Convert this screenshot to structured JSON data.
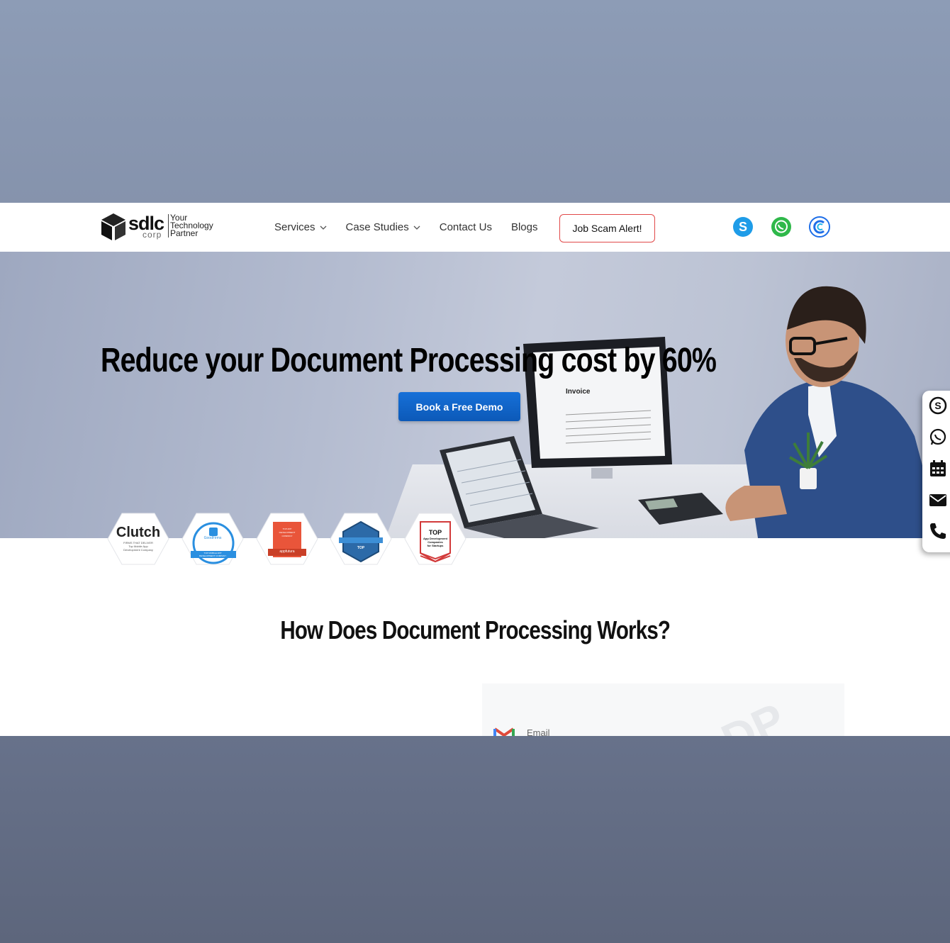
{
  "header": {
    "logo": {
      "word": "sdlc",
      "corp": "corp",
      "tagline": [
        "Your",
        "Technology",
        "Partner"
      ]
    },
    "nav": [
      {
        "label": "Services",
        "has_dropdown": true
      },
      {
        "label": "Case Studies",
        "has_dropdown": true
      },
      {
        "label": "Contact Us",
        "has_dropdown": false
      },
      {
        "label": "Blogs",
        "has_dropdown": false
      }
    ],
    "alert_button": "Job Scam Alert!",
    "icons": [
      "skype-icon",
      "whatsapp-icon",
      "calendly-icon"
    ]
  },
  "hero": {
    "title": "Reduce your Document Processing cost by 60%",
    "cta": "Book a Free Demo",
    "image_text": "Invoice",
    "badges": [
      {
        "name": "clutch-badge",
        "title": "Clutch",
        "lines": [
          "FIRMS THAT DELIVER",
          "Top Mobile App",
          "Development Company"
        ]
      },
      {
        "name": "goodfirms-badge",
        "title": "GoodFirms",
        "lines": [
          "TOP MOBILE APP",
          "DEVELOPMENT COMPANY"
        ]
      },
      {
        "name": "appfutura-badge",
        "title": "appfutura",
        "lines": [
          "TOP APP",
          "DEVELOPMENT",
          "COMPANY"
        ]
      },
      {
        "name": "top-developers-badge",
        "title": "TOP",
        "lines": []
      },
      {
        "name": "top-startups-badge",
        "title": "TOP",
        "lines": [
          "App Development",
          "Companies",
          "for Startups"
        ]
      }
    ]
  },
  "side_widget": [
    "skype-icon",
    "whatsapp-icon",
    "calendar-icon",
    "email-icon",
    "phone-icon"
  ],
  "section": {
    "title": "How Does Document Processing Works?",
    "diagram_label": "Email"
  },
  "colors": {
    "cta": "#1670d8",
    "alert_border": "#e14848",
    "skype": "#1e9ce8",
    "whatsapp": "#2fb84a",
    "calendly": "#1f6fe8"
  }
}
